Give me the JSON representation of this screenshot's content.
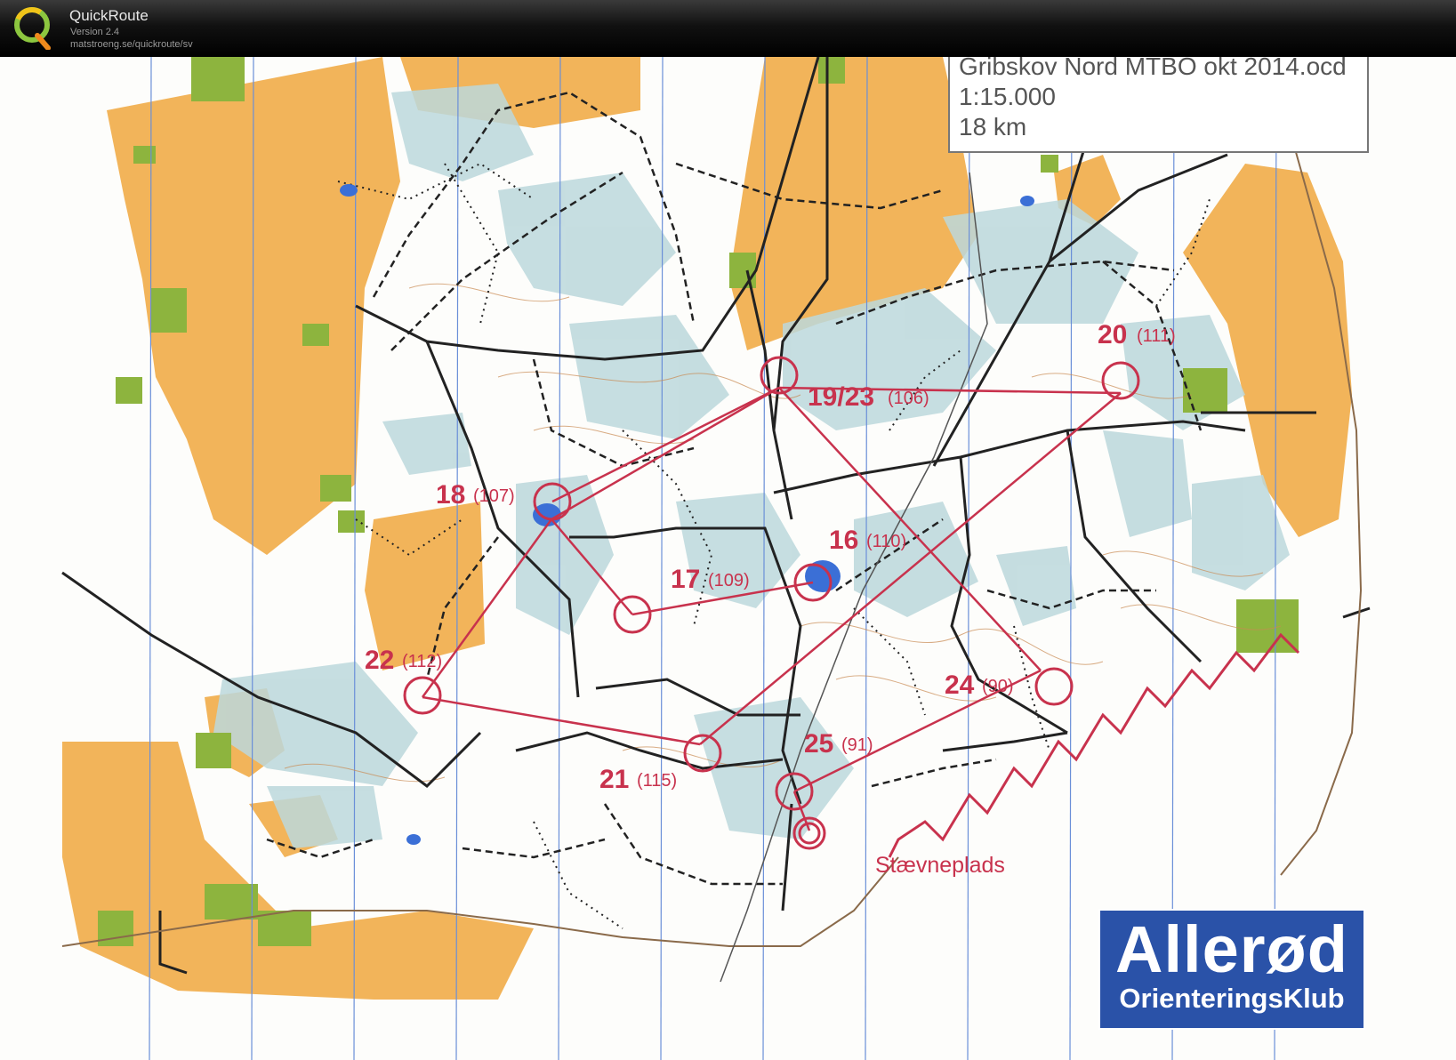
{
  "app": {
    "name": "QuickRoute",
    "version": "Version 2.4",
    "url": "matstroeng.se/quickroute/sv",
    "logo_letter": "Q"
  },
  "map_info": {
    "line1": "Gribskov Nord MTBO okt 2014.ocd",
    "line2": "1:15.000",
    "line3": "18 km"
  },
  "controls": [
    {
      "label": "18",
      "code": "(107)"
    },
    {
      "label": "19/23",
      "code": "(106)"
    },
    {
      "label": "20",
      "code": "(111)"
    },
    {
      "label": "16",
      "code": "(110)"
    },
    {
      "label": "17",
      "code": "(109)"
    },
    {
      "label": "22",
      "code": "(112)"
    },
    {
      "label": "24",
      "code": "(90)"
    },
    {
      "label": "25",
      "code": "(91)"
    },
    {
      "label": "21",
      "code": "(115)"
    }
  ],
  "venue_label": "Stævneplads",
  "club": {
    "name": "Allerød",
    "sub": "OrienteringsKlub"
  },
  "colors": {
    "course": "#c8324d",
    "open_land": "#f2b45a",
    "vegetation": "#bcd8dc",
    "green": "#8db43e",
    "club_blue": "#2a52a8"
  }
}
